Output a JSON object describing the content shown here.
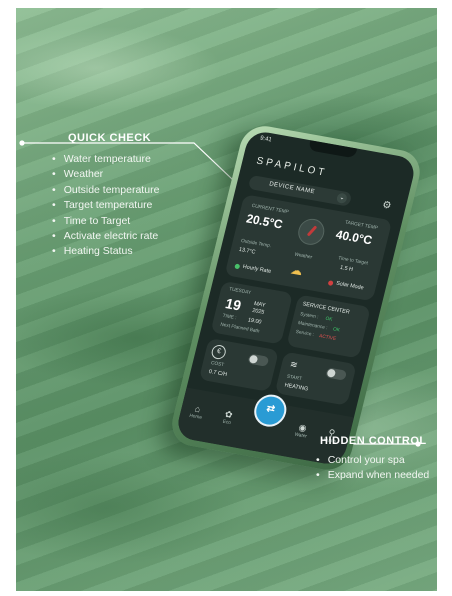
{
  "quick_check": {
    "title": "QUICK CHECK",
    "items": [
      "Water temperature",
      "Weather",
      "Outside temperature",
      "Target temperature",
      "Time to Target",
      "Activate electric rate",
      "Heating Status"
    ]
  },
  "hidden_control": {
    "title": "HIDDEN CONTROL",
    "items": [
      "Control your spa",
      "Expand when needed"
    ]
  },
  "app": {
    "status_time": "9:41",
    "logo": "SPAPILOT",
    "device_name": "DEVICE NAME",
    "current_temp_label": "CURRENT TEMP",
    "current_temp": "20.5°C",
    "target_temp_label": "TARGET TEMP",
    "target_temp": "40.0°C",
    "outside_temp_label": "Outside Temp.",
    "outside_temp": "13.7°C",
    "weather_label": "Weather",
    "time_to_target_label": "Time to Target",
    "time_to_target": "1.5 H",
    "hourly_rate": "Hourly Rate",
    "solar_mode": "Solar Mode",
    "day_name": "TUESDAY",
    "day": "19",
    "month": "MAY",
    "year": "2025",
    "time_label": "TIME :",
    "time": "19:00",
    "next_bath": "Next Planned Bath",
    "service_center": "SERVICE CENTER",
    "system_label": "System :",
    "system_status": "OK",
    "maintenance_label": "Maintenance :",
    "maintenance_status": "OK",
    "service_label": "Service :",
    "service_status": "ACTIVE",
    "cost_label": "COST",
    "cost_value": "0.7 C/H",
    "start_label": "START",
    "heating_label": "HEATING",
    "nav": [
      "Home",
      "Eco",
      "Water",
      "Pump"
    ]
  }
}
